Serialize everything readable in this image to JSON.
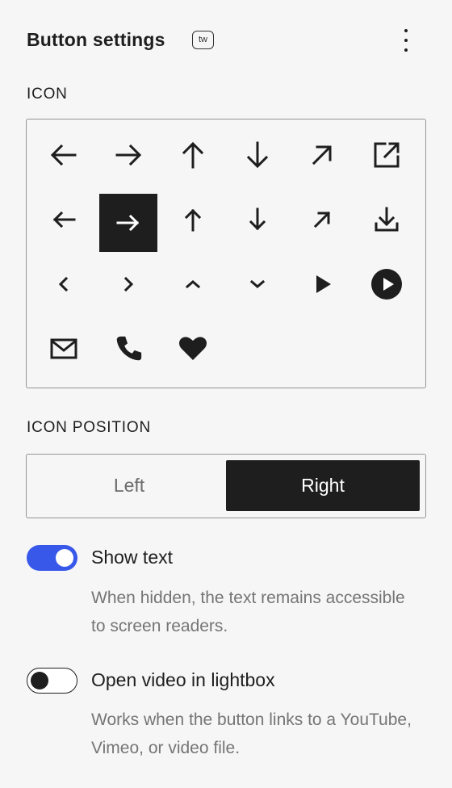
{
  "panel": {
    "title": "Button settings",
    "badge": "tw"
  },
  "icon_section": {
    "label": "ICON",
    "icons": [
      "arrow-left-icon",
      "arrow-right-icon",
      "arrow-up-icon",
      "arrow-down-icon",
      "arrow-up-right-icon",
      "external-link-icon",
      "arrow-left-short-icon",
      "arrow-right-short-icon",
      "arrow-up-short-icon",
      "arrow-down-short-icon",
      "arrow-up-right-short-icon",
      "download-icon",
      "chevron-left-icon",
      "chevron-right-icon",
      "chevron-up-icon",
      "chevron-down-icon",
      "play-icon",
      "play-circle-icon",
      "envelope-icon",
      "phone-icon",
      "heart-icon"
    ],
    "selected": "arrow-right-short-icon"
  },
  "position_section": {
    "label": "ICON POSITION",
    "options": [
      "Left",
      "Right"
    ],
    "selected": "Right"
  },
  "show_text": {
    "label": "Show text",
    "checked": true,
    "help": "When hidden, the text remains accessible to screen readers."
  },
  "lightbox": {
    "label": "Open video in lightbox",
    "checked": false,
    "help": "Works when the button links to a YouTube, Vimeo, or video file."
  },
  "colors": {
    "toggle_on": "#3858e9",
    "selected_bg": "#1e1e1e",
    "help_text": "#757575"
  }
}
